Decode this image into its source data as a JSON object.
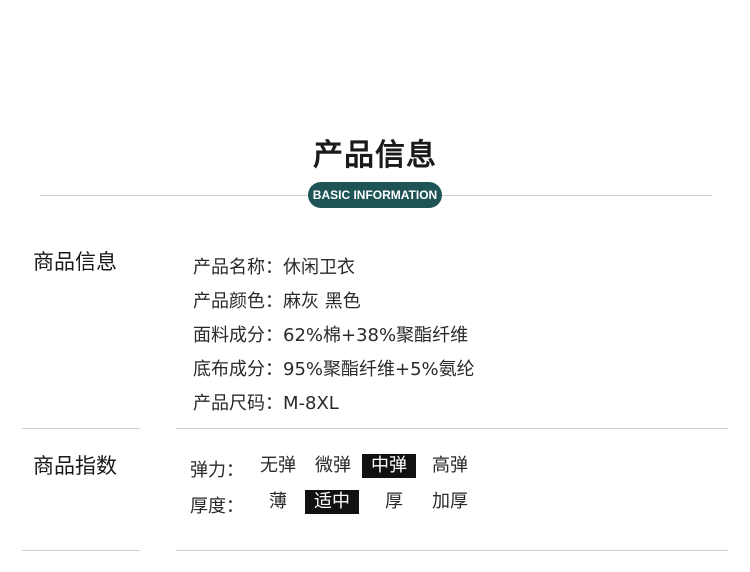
{
  "header": {
    "title": "产品信息",
    "badge": "BASIC INFORMATION"
  },
  "info_section": {
    "heading": "商品信息",
    "lines": [
      "产品名称：休闲卫衣",
      "产品颜色：麻灰 黑色",
      "面料成分：62%棉+38%聚酯纤维",
      "底布成分：95%聚酯纤维+5%氨纶",
      "产品尺码：M-8XL"
    ]
  },
  "index_section": {
    "heading": "商品指数",
    "elasticity": {
      "label": "弹力：",
      "options": [
        "无弹",
        "微弹",
        "中弹",
        "高弹"
      ],
      "selected": "中弹"
    },
    "thickness": {
      "label": "厚度：",
      "options": [
        "薄",
        "适中",
        "厚",
        "加厚"
      ],
      "selected": "适中"
    }
  },
  "colors": {
    "badge_bg": "#1e5455",
    "selected_bg": "#111111"
  }
}
